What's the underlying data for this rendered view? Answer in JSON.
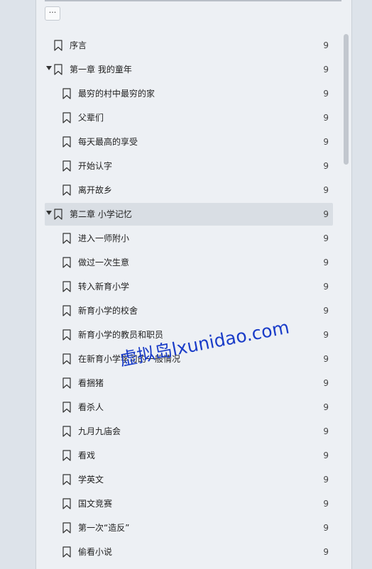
{
  "toolbar": {
    "menu_label": "···"
  },
  "outline": {
    "items": [
      {
        "label": "序言",
        "page": "9",
        "level": 0,
        "expandable": false
      },
      {
        "label": "第一章 我的童年",
        "page": "9",
        "level": 0,
        "expandable": true
      },
      {
        "label": "最穷的村中最穷的家",
        "page": "9",
        "level": 1,
        "expandable": false
      },
      {
        "label": "父辈们",
        "page": "9",
        "level": 1,
        "expandable": false
      },
      {
        "label": "每天最高的享受",
        "page": "9",
        "level": 1,
        "expandable": false
      },
      {
        "label": "开始认字",
        "page": "9",
        "level": 1,
        "expandable": false
      },
      {
        "label": "离开故乡",
        "page": "9",
        "level": 1,
        "expandable": false
      },
      {
        "label": "第二章 小学记忆",
        "page": "9",
        "level": 0,
        "expandable": true,
        "selected": true
      },
      {
        "label": "进入一师附小",
        "page": "9",
        "level": 1,
        "expandable": false
      },
      {
        "label": "做过一次生意",
        "page": "9",
        "level": 1,
        "expandable": false
      },
      {
        "label": "转入新育小学",
        "page": "9",
        "level": 1,
        "expandable": false
      },
      {
        "label": "新育小学的校舍",
        "page": "9",
        "level": 1,
        "expandable": false
      },
      {
        "label": "新育小学的教员和职员",
        "page": "9",
        "level": 1,
        "expandable": false
      },
      {
        "label": "在新育小学学习的一般情况",
        "page": "9",
        "level": 1,
        "expandable": false
      },
      {
        "label": "看捆猪",
        "page": "9",
        "level": 1,
        "expandable": false
      },
      {
        "label": "看杀人",
        "page": "9",
        "level": 1,
        "expandable": false
      },
      {
        "label": "九月九庙会",
        "page": "9",
        "level": 1,
        "expandable": false
      },
      {
        "label": "看戏",
        "page": "9",
        "level": 1,
        "expandable": false
      },
      {
        "label": "学英文",
        "page": "9",
        "level": 1,
        "expandable": false
      },
      {
        "label": "国文竞赛",
        "page": "9",
        "level": 1,
        "expandable": false
      },
      {
        "label": "第一次“造反”",
        "page": "9",
        "level": 1,
        "expandable": false
      },
      {
        "label": "偷看小说",
        "page": "9",
        "level": 1,
        "expandable": false
      }
    ]
  },
  "watermark": {
    "text": "虚拟岛lxunidao.com",
    "color": "#1a3cc8"
  },
  "colors": {
    "panel_bg": "#edf0f4",
    "outer_bg": "#dde3ea",
    "selected_bg": "#d9dee4"
  },
  "icons": {
    "bookmark": "bookmark-icon",
    "expand": "caret-down-icon",
    "menu": "more-icon"
  }
}
